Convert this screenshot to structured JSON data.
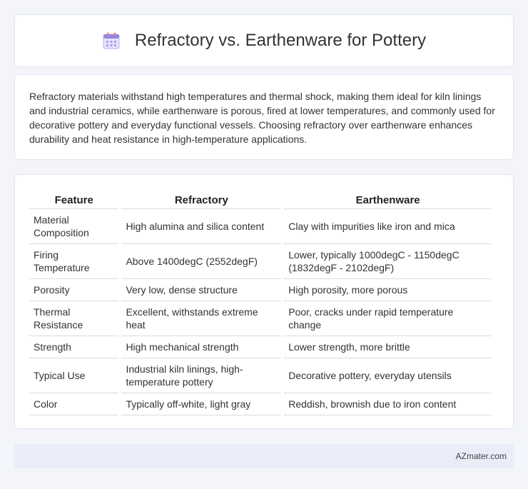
{
  "header": {
    "icon": "calendar-icon",
    "title": "Refractory vs. Earthenware for Pottery"
  },
  "summary": {
    "text": "Refractory materials withstand high temperatures and thermal shock, making them ideal for kiln linings and industrial ceramics, while earthenware is porous, fired at lower temperatures, and commonly used for decorative pottery and everyday functional vessels. Choosing refractory over earthenware enhances durability and heat resistance in high-temperature applications."
  },
  "table": {
    "headers": [
      "Feature",
      "Refractory",
      "Earthenware"
    ],
    "rows": [
      [
        "Material Composition",
        "High alumina and silica content",
        "Clay with impurities like iron and mica"
      ],
      [
        "Firing Temperature",
        "Above 1400degC (2552degF)",
        "Lower, typically 1000degC - 1150degC (1832degF - 2102degF)"
      ],
      [
        "Porosity",
        "Very low, dense structure",
        "High porosity, more porous"
      ],
      [
        "Thermal Resistance",
        "Excellent, withstands extreme heat",
        "Poor, cracks under rapid temperature change"
      ],
      [
        "Strength",
        "High mechanical strength",
        "Lower strength, more brittle"
      ],
      [
        "Typical Use",
        "Industrial kiln linings, high-temperature pottery",
        "Decorative pottery, everyday utensils"
      ],
      [
        "Color",
        "Typically off-white, light gray",
        "Reddish, brownish due to iron content"
      ]
    ]
  },
  "footer": {
    "text": "AZmater.com"
  }
}
